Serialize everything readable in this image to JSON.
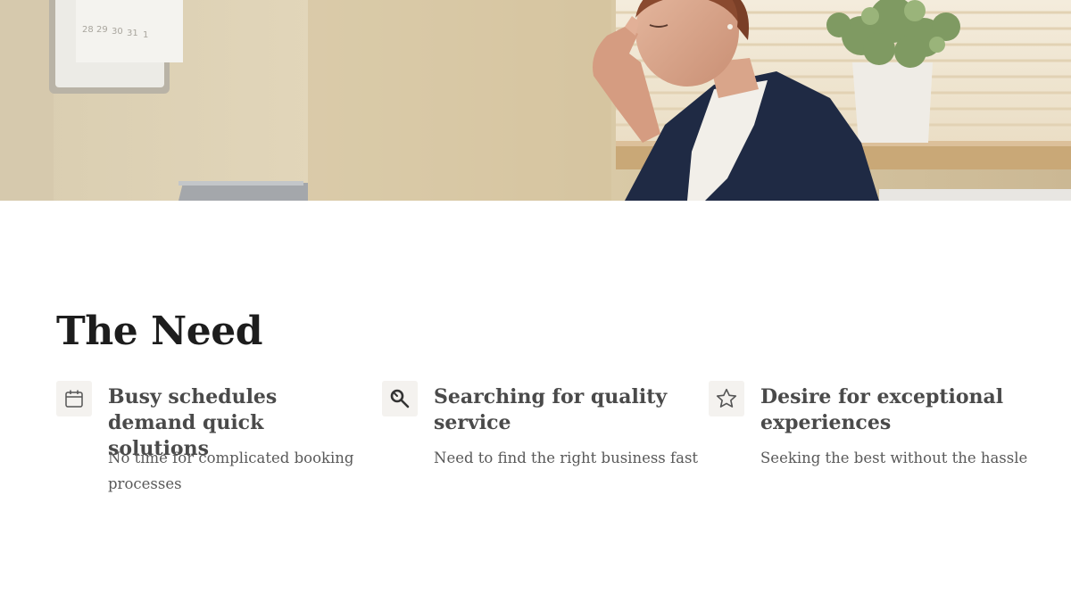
{
  "hero": {
    "image_subject": "stressed-woman-at-desk-photo"
  },
  "section": {
    "title": "The Need"
  },
  "features": [
    {
      "icon": "calendar-icon",
      "heading": "Busy schedules demand quick solutions",
      "description": "No time for complicated booking processes"
    },
    {
      "icon": "magnifier-icon",
      "heading": "Searching for quality service",
      "description": "Need to find the right business fast"
    },
    {
      "icon": "star-icon",
      "heading": "Desire for exceptional experiences",
      "description": "Seeking the best without the hassle"
    }
  ],
  "colors": {
    "title": "#1d1d1d",
    "heading": "#4a4a4a",
    "body": "#595959",
    "icon_bg": "#f4f2ef",
    "icon_stroke": "#555555"
  }
}
